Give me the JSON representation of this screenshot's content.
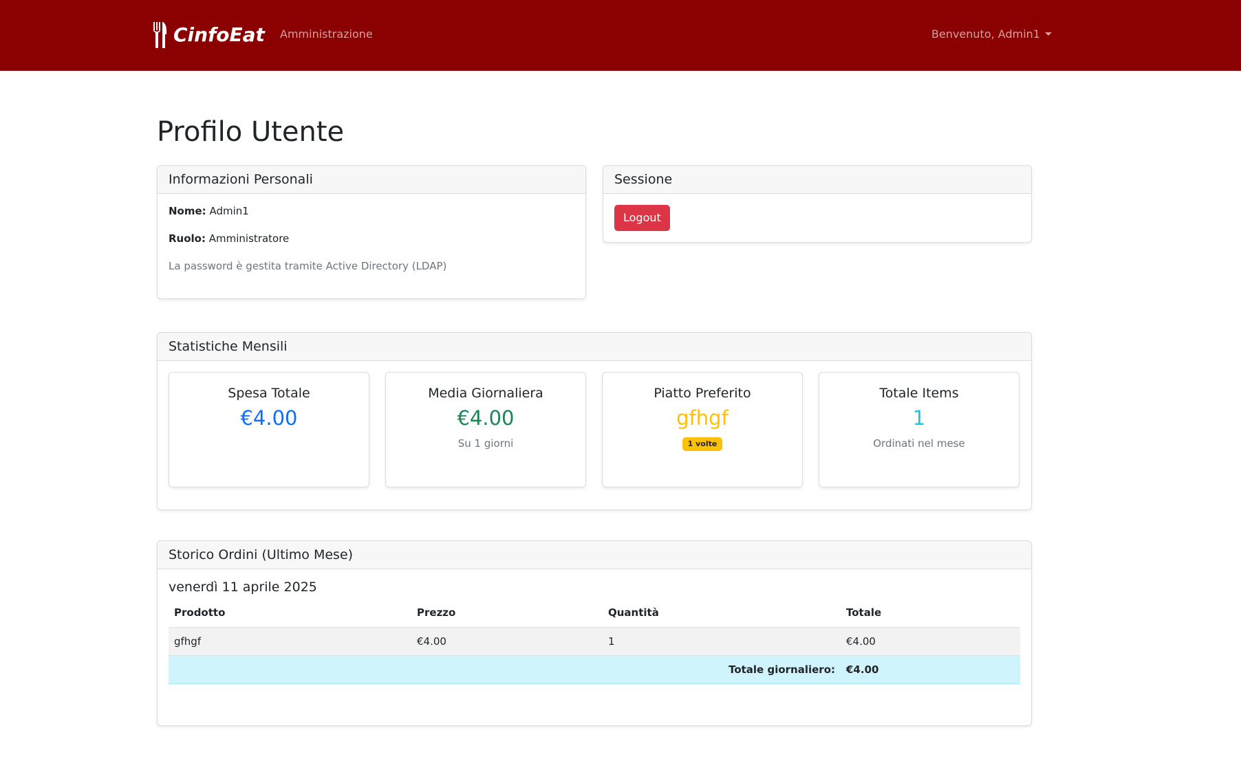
{
  "navbar": {
    "brand": "CinfoEat",
    "admin_link": "Amministrazione",
    "user_menu": "Benvenuto, Admin1"
  },
  "page": {
    "title": "Profilo Utente"
  },
  "personal_info": {
    "header": "Informazioni Personali",
    "name_label": "Nome:",
    "name_value": "Admin1",
    "role_label": "Ruolo:",
    "role_value": "Amministratore",
    "password_note": "La password è gestita tramite Active Directory (LDAP)"
  },
  "session": {
    "header": "Sessione",
    "logout_label": "Logout"
  },
  "stats": {
    "header": "Statistiche Mensili",
    "total_spend": {
      "title": "Spesa Totale",
      "value": "€4.00",
      "color": "#0d6efd"
    },
    "daily_average": {
      "title": "Media Giornaliera",
      "value": "€4.00",
      "sub": "Su 1 giorni",
      "color": "#198754"
    },
    "favorite_dish": {
      "title": "Piatto Preferito",
      "value": "gfhgf",
      "badge": "1 volte",
      "color": "#ffc107"
    },
    "total_items": {
      "title": "Totale Items",
      "value": "1",
      "sub": "Ordinati nel mese",
      "color": "#0dcaf0"
    }
  },
  "orders": {
    "header": "Storico Ordini (Ultimo Mese)",
    "date": "venerdì 11 aprile 2025",
    "columns": [
      "Prodotto",
      "Prezzo",
      "Quantità",
      "Totale"
    ],
    "rows": [
      [
        "gfhgf",
        "€4.00",
        "1",
        "€4.00"
      ]
    ],
    "daily_total_label": "Totale giornaliero:",
    "daily_total_value": "€4.00"
  },
  "colors": {
    "navbar": "#8b0000",
    "danger": "#dc3545",
    "info_row": "#cff4fc"
  }
}
